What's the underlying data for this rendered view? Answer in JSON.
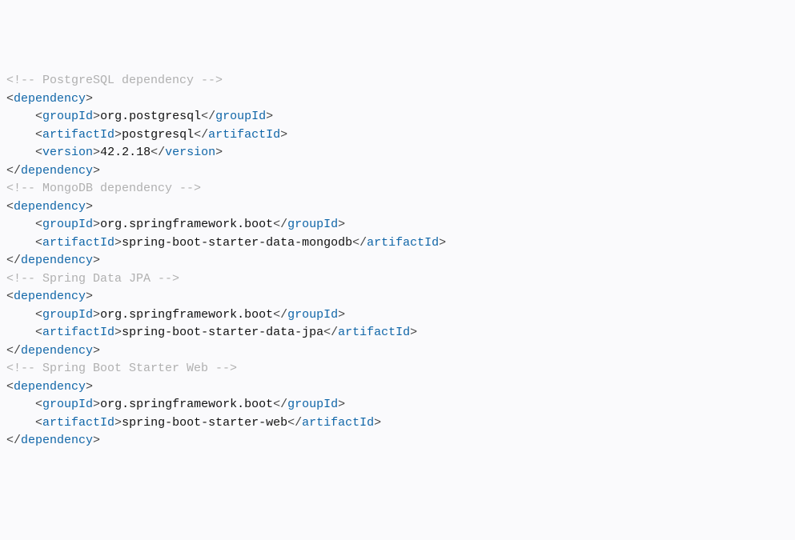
{
  "lines": [
    {
      "type": "comment",
      "text": "<!-- PostgreSQL dependency -->"
    },
    {
      "type": "open",
      "tag": "dependency",
      "indent": 0
    },
    {
      "type": "leaf",
      "tag": "groupId",
      "value": "org.postgresql",
      "indent": 1
    },
    {
      "type": "leaf",
      "tag": "artifactId",
      "value": "postgresql",
      "indent": 1
    },
    {
      "type": "leaf",
      "tag": "version",
      "value": "42.2.18",
      "indent": 1
    },
    {
      "type": "close",
      "tag": "dependency",
      "indent": 0
    },
    {
      "type": "comment",
      "text": "<!-- MongoDB dependency -->"
    },
    {
      "type": "open",
      "tag": "dependency",
      "indent": 0
    },
    {
      "type": "leaf",
      "tag": "groupId",
      "value": "org.springframework.boot",
      "indent": 1
    },
    {
      "type": "leaf",
      "tag": "artifactId",
      "value": "spring-boot-starter-data-mongodb",
      "indent": 1
    },
    {
      "type": "close",
      "tag": "dependency",
      "indent": 0
    },
    {
      "type": "comment",
      "text": "<!-- Spring Data JPA -->"
    },
    {
      "type": "open",
      "tag": "dependency",
      "indent": 0
    },
    {
      "type": "leaf",
      "tag": "groupId",
      "value": "org.springframework.boot",
      "indent": 1
    },
    {
      "type": "leaf",
      "tag": "artifactId",
      "value": "spring-boot-starter-data-jpa",
      "indent": 1
    },
    {
      "type": "close",
      "tag": "dependency",
      "indent": 0
    },
    {
      "type": "comment",
      "text": "<!-- Spring Boot Starter Web -->"
    },
    {
      "type": "open",
      "tag": "dependency",
      "indent": 0
    },
    {
      "type": "leaf",
      "tag": "groupId",
      "value": "org.springframework.boot",
      "indent": 1
    },
    {
      "type": "leaf",
      "tag": "artifactId",
      "value": "spring-boot-starter-web",
      "indent": 1
    },
    {
      "type": "close",
      "tag": "dependency",
      "indent": 0
    }
  ],
  "indent_unit": "    "
}
